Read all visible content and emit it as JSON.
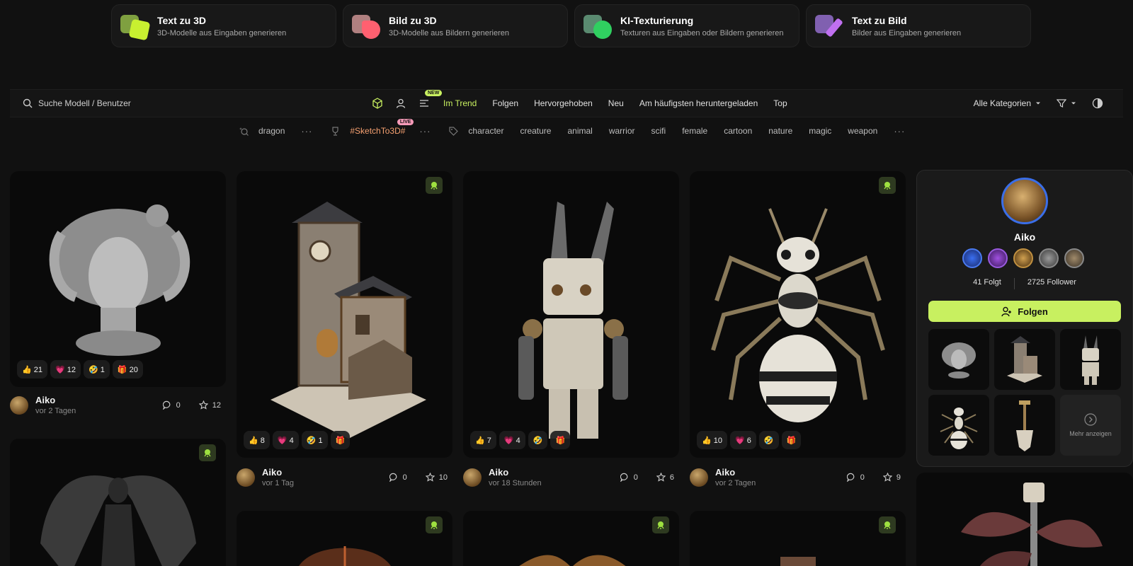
{
  "features": [
    {
      "title": "Text zu 3D",
      "subtitle": "3D-Modelle aus Eingaben generieren",
      "back": "#7fa040",
      "front": "#c8f030"
    },
    {
      "title": "Bild zu 3D",
      "subtitle": "3D-Modelle aus Bildern generieren",
      "back": "#b08080",
      "front": "#ff6070"
    },
    {
      "title": "KI-Texturierung",
      "subtitle": "Texturen aus Eingaben oder Bildern generieren",
      "back": "#5a8a70",
      "front": "#30d060"
    },
    {
      "title": "Text zu Bild",
      "subtitle": "Bilder aus Eingaben generieren",
      "back": "#8060b0",
      "front": "#c070f0"
    }
  ],
  "search": {
    "placeholder": "Suche Modell / Benutzer"
  },
  "nav": {
    "new_badge": "NEW",
    "tabs": [
      "Im Trend",
      "Folgen",
      "Hervorgehoben",
      "Neu",
      "Am häufigsten heruntergeladen",
      "Top"
    ]
  },
  "category": {
    "label": "Alle Kategorien"
  },
  "tags": {
    "search_tag": "dragon",
    "challenge": "#SketchTo3D#",
    "live_badge": "LIVE",
    "more": "···",
    "items": [
      "character",
      "creature",
      "animal",
      "warrior",
      "scifi",
      "female",
      "cartoon",
      "nature",
      "magic",
      "weapon"
    ]
  },
  "cards": [
    {
      "author": "Aiko",
      "time": "vor 2 Tagen",
      "comments": "0",
      "stars": "12",
      "reactions": [
        "👍 21",
        "💗 12",
        "🤣 1",
        "🎁 20"
      ]
    },
    {
      "author": "Aiko",
      "time": "vor 1 Tag",
      "comments": "0",
      "stars": "10",
      "reactions": [
        "👍 8",
        "💗 4",
        "🤣 1",
        "🎁"
      ]
    },
    {
      "author": "Aiko",
      "time": "vor 18 Stunden",
      "comments": "0",
      "stars": "6",
      "reactions": [
        "👍 7",
        "💗 4",
        "🤣",
        "🎁"
      ]
    },
    {
      "author": "Aiko",
      "time": "vor 2 Tagen",
      "comments": "0",
      "stars": "9",
      "reactions": [
        "👍 10",
        "💗 6",
        "🤣",
        "🎁"
      ]
    }
  ],
  "profile": {
    "name": "Aiko",
    "following": "41 Folgt",
    "followers": "2725 Follower",
    "follow_label": "Folgen",
    "more_label": "Mehr anzeigen"
  },
  "colors": {
    "accent": "#c8f060",
    "background": "#111111"
  }
}
